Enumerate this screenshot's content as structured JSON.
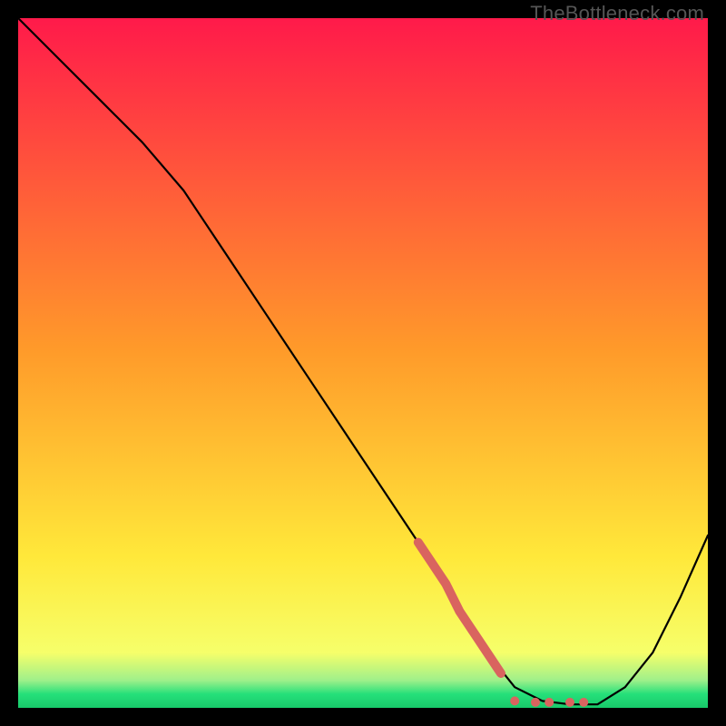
{
  "watermark": "TheBottleneck.com",
  "colors": {
    "gradient_top": "#ff1a4a",
    "gradient_mid": "#ffd83a",
    "gradient_bottom_band": "#25e07a",
    "gradient_bottom_edge": "#18c96a",
    "line": "#000000",
    "accent": "#d9645f",
    "frame": "#000000"
  },
  "chart_data": {
    "type": "line",
    "title": "",
    "xlabel": "",
    "ylabel": "",
    "xlim": [
      0,
      100
    ],
    "ylim": [
      0,
      100
    ],
    "series": [
      {
        "name": "main-curve",
        "x": [
          0,
          6,
          12,
          18,
          24,
          26,
          30,
          36,
          42,
          48,
          54,
          58,
          60,
          64,
          68,
          72,
          76,
          80,
          84,
          88,
          92,
          96,
          100
        ],
        "y": [
          100,
          94,
          88,
          82,
          75,
          72,
          66,
          57,
          48,
          39,
          30,
          24,
          21,
          14,
          8,
          3,
          1,
          0.5,
          0.5,
          3,
          8,
          16,
          25
        ]
      }
    ],
    "accent_segment": {
      "name": "highlight-diagonal",
      "x": [
        58,
        60,
        62,
        64,
        66,
        68,
        70
      ],
      "y": [
        24,
        21,
        18,
        14,
        11,
        8,
        5
      ]
    },
    "accent_dots": {
      "name": "highlight-floor",
      "points": [
        {
          "x": 72,
          "y": 1.0
        },
        {
          "x": 75,
          "y": 0.8
        },
        {
          "x": 77,
          "y": 0.8
        },
        {
          "x": 80,
          "y": 0.8
        },
        {
          "x": 82,
          "y": 0.8
        }
      ]
    }
  }
}
